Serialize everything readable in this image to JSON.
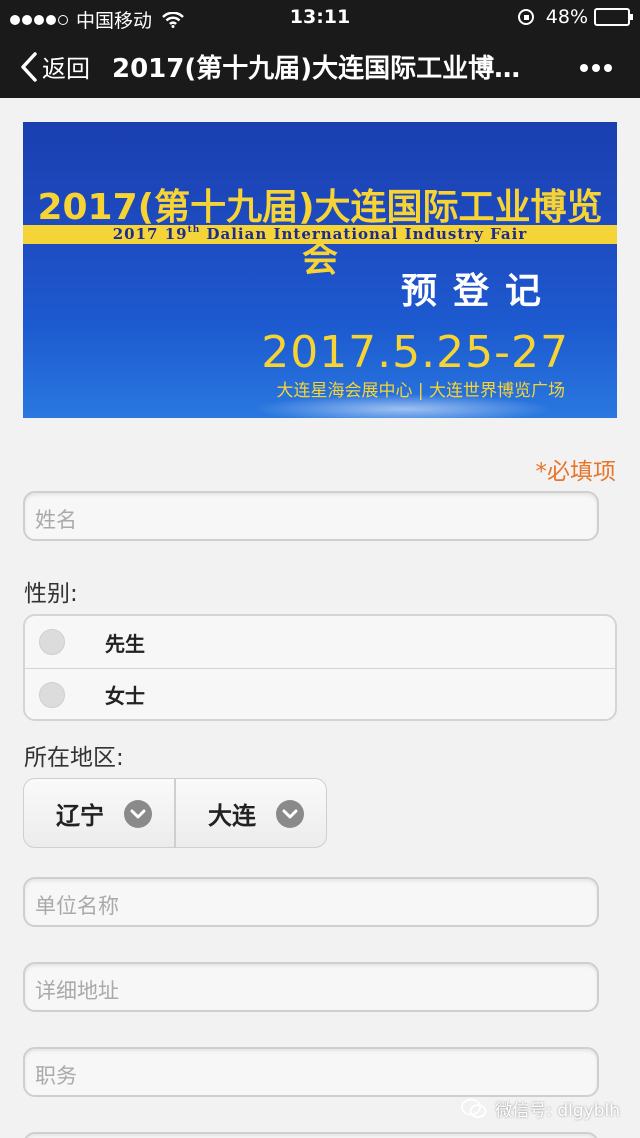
{
  "status": {
    "carrier": "中国移动",
    "time": "13:11",
    "battery": "48%",
    "battery_level": 0.48
  },
  "nav": {
    "back": "返回",
    "title": "2017(第十九届)大连国际工业博…"
  },
  "banner": {
    "title_cn": "2017(第十九届)大连国际工业博览会",
    "title_en_prefix": "2017 19",
    "title_en_sup": "th",
    "title_en_rest": " Dalian International Industry Fair",
    "prereg": "预登记",
    "date": "2017.5.25-27",
    "venue": "大连星海会展中心 | 大连世界博览广场"
  },
  "form": {
    "required_note": "*必填项",
    "name_placeholder": "姓名",
    "gender_label": "性别:",
    "gender_options": [
      "先生",
      "女士"
    ],
    "region_label": "所在地区:",
    "province": "辽宁",
    "city": "大连",
    "company_placeholder": "单位名称",
    "address_placeholder": "详细地址",
    "position_placeholder": "职务"
  },
  "watermark": "微信号: dlgyblh",
  "icons": [
    "back-chevron-icon",
    "more-icon",
    "wifi-icon",
    "rotation-lock-icon",
    "battery-icon",
    "chevron-down-icon",
    "wechat-icon"
  ]
}
